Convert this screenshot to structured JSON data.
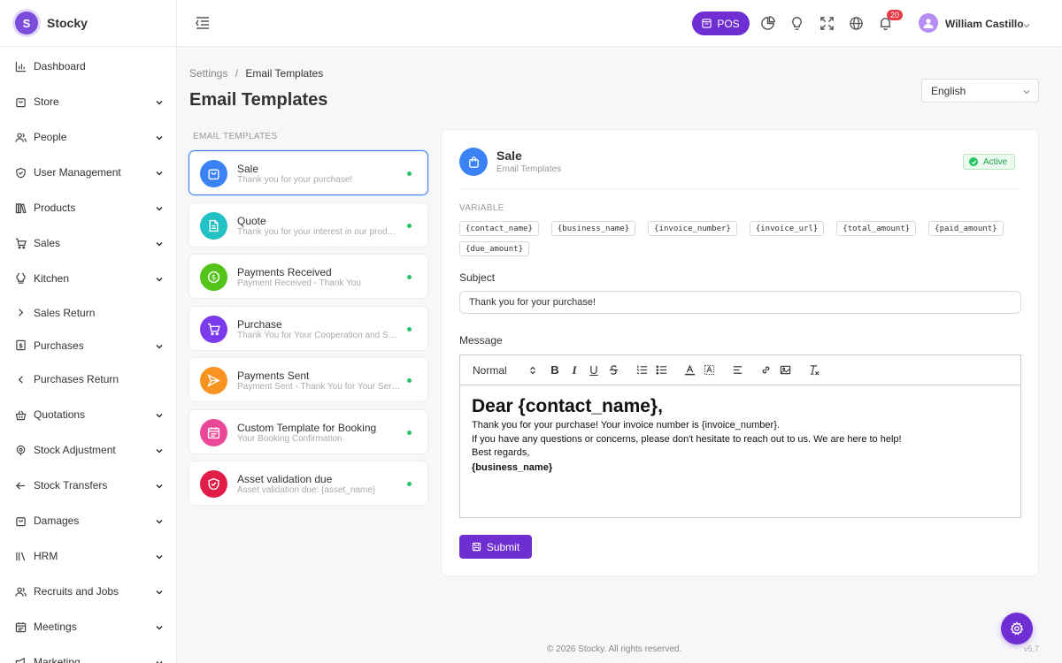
{
  "brand": {
    "logo_letter": "S",
    "name": "Stocky"
  },
  "sidebar": {
    "items": [
      {
        "label": "Dashboard",
        "icon": "bar-chart-icon",
        "has_chevron": false
      },
      {
        "label": "Store",
        "icon": "shopping-bag-icon",
        "has_chevron": true
      },
      {
        "label": "People",
        "icon": "users-icon",
        "has_chevron": true
      },
      {
        "label": "User Management",
        "icon": "shield-icon",
        "has_chevron": true
      },
      {
        "label": "Products",
        "icon": "books-icon",
        "has_chevron": true
      },
      {
        "label": "Sales",
        "icon": "cart-icon",
        "has_chevron": true
      },
      {
        "label": "Kitchen",
        "icon": "chef-hat-icon",
        "has_chevron": true
      },
      {
        "label": "Sales Return",
        "icon": "chevron-right-icon",
        "has_chevron": false
      },
      {
        "label": "Purchases",
        "icon": "receipt-icon",
        "has_chevron": true
      },
      {
        "label": "Purchases Return",
        "icon": "chevron-left-icon",
        "has_chevron": false
      },
      {
        "label": "Quotations",
        "icon": "basket-icon",
        "has_chevron": true
      },
      {
        "label": "Stock Adjustment",
        "icon": "target-icon",
        "has_chevron": true
      },
      {
        "label": "Stock Transfers",
        "icon": "arrow-left-icon",
        "has_chevron": true
      },
      {
        "label": "Damages",
        "icon": "bag-icon",
        "has_chevron": true
      },
      {
        "label": "HRM",
        "icon": "library-icon",
        "has_chevron": true
      },
      {
        "label": "Recruits and Jobs",
        "icon": "users-icon",
        "has_chevron": true
      },
      {
        "label": "Meetings",
        "icon": "calendar-icon",
        "has_chevron": true
      },
      {
        "label": "Marketing",
        "icon": "megaphone-icon",
        "has_chevron": true
      }
    ]
  },
  "topbar": {
    "pos_label": "POS",
    "notification_count": "20",
    "user_name": "William Castillo"
  },
  "breadcrumb": {
    "parent": "Settings",
    "separator": "/",
    "current": "Email Templates"
  },
  "page_title": "Email Templates",
  "language": {
    "selected": "English"
  },
  "templates": {
    "section_label": "EMAIL TEMPLATES",
    "items": [
      {
        "name": "Sale",
        "desc": "Thank you for your purchase!",
        "color": "#3b82f6",
        "icon": "shopping-bag-icon",
        "active": true
      },
      {
        "name": "Quote",
        "desc": "Thank you for your interest in our products",
        "color": "#22c1c3",
        "icon": "document-icon",
        "active": false
      },
      {
        "name": "Payments Received",
        "desc": "Payment Received - Thank You",
        "color": "#52c41a",
        "icon": "dollar-icon",
        "active": false
      },
      {
        "name": "Purchase",
        "desc": "Thank You for Your Cooperation and Service",
        "color": "#7c3aed",
        "icon": "cart-icon",
        "active": false
      },
      {
        "name": "Payments Sent",
        "desc": "Payment Sent - Thank You for Your Service",
        "color": "#f7931e",
        "icon": "send-icon",
        "active": false
      },
      {
        "name": "Custom Template for Booking",
        "desc": "Your Booking Confirmation",
        "color": "#ec4899",
        "icon": "calendar-icon",
        "active": false
      },
      {
        "name": "Asset validation due",
        "desc": "Asset validation due: {asset_name}",
        "color": "#e11d48",
        "icon": "shield-check-icon",
        "active": false
      }
    ]
  },
  "editor": {
    "title": "Sale",
    "subtitle": "Email Templates",
    "status": "Active",
    "variable_label": "VARIABLE",
    "variables": [
      "{contact_name}",
      "{business_name}",
      "{invoice_number}",
      "{invoice_url}",
      "{total_amount}",
      "{paid_amount}",
      "{due_amount}"
    ],
    "subject_label": "Subject",
    "subject_value": "Thank you for your purchase!",
    "message_label": "Message",
    "toolbar_format": "Normal",
    "body": {
      "heading": "Dear  {contact_name},",
      "line1": "Thank you for your purchase! Your invoice number is {invoice_number}.",
      "line2": "If you have any questions or concerns, please don't hesitate to reach out to us. We are here to help!",
      "line3": "Best regards,",
      "signature": "{business_name}"
    },
    "submit_label": "Submit"
  },
  "footer": {
    "copyright": "© 2026 Stocky. All rights reserved.",
    "version": "v5.7"
  },
  "colors": {
    "accent": "#6f2ed1",
    "primary": "#3b82f6",
    "success": "#22c55e",
    "danger": "#e63946"
  }
}
